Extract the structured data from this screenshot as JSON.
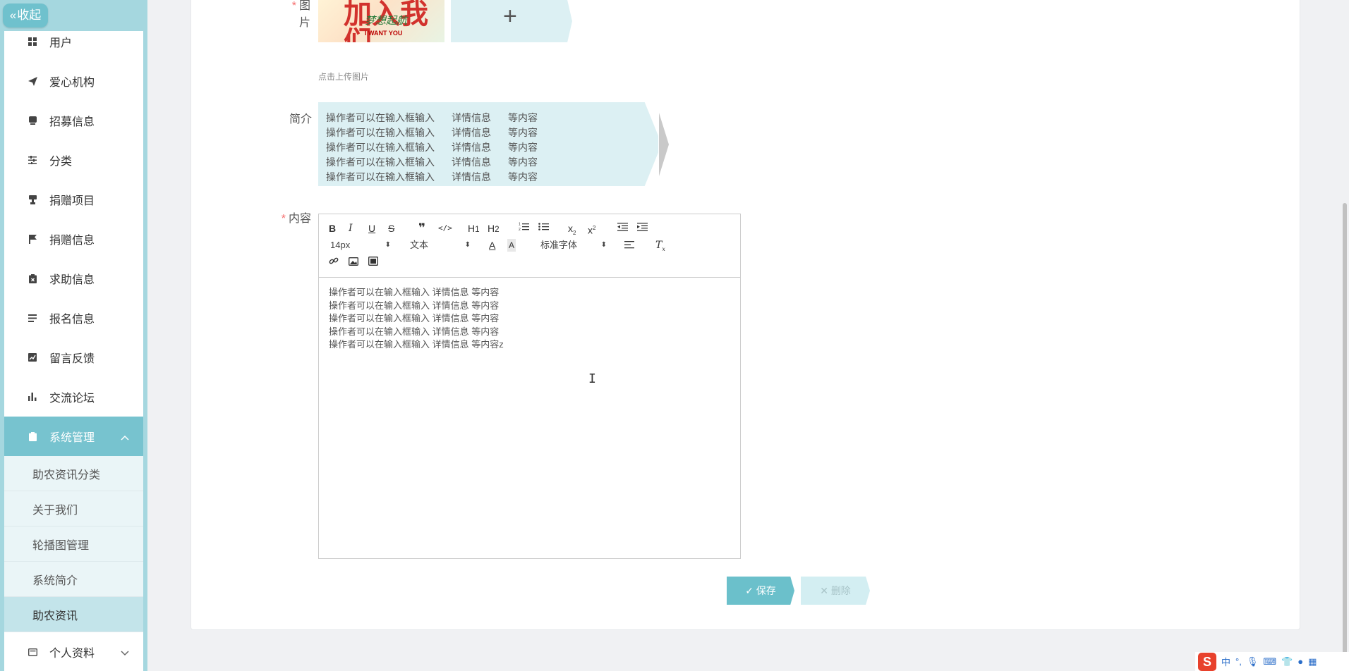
{
  "sidebar": {
    "collapse_label": "收起",
    "items": [
      {
        "label": "用户",
        "icon": "grid-icon"
      },
      {
        "label": "爱心机构",
        "icon": "send-icon"
      },
      {
        "label": "招募信息",
        "icon": "bookmark-icon"
      },
      {
        "label": "分类",
        "icon": "sliders-icon"
      },
      {
        "label": "捐赠项目",
        "icon": "stamp-icon"
      },
      {
        "label": "捐赠信息",
        "icon": "flag-icon"
      },
      {
        "label": "求助信息",
        "icon": "clipboard-x-icon"
      },
      {
        "label": "报名信息",
        "icon": "list-icon"
      },
      {
        "label": "留言反馈",
        "icon": "chart-line-icon"
      },
      {
        "label": "交流论坛",
        "icon": "bar-chart-icon"
      },
      {
        "label": "系统管理",
        "icon": "clipboard-icon"
      }
    ],
    "sub_items": [
      "助农资讯分类",
      "关于我们",
      "轮播图管理",
      "系统简介",
      "助农资讯"
    ],
    "profile_label": "个人资料"
  },
  "form": {
    "image_label": "图片",
    "upload_hint": "点击上传图片",
    "thumb_text_main": "加入我们",
    "thumb_text_sub": "梦想起航",
    "thumb_text_en": "I WANT YOU",
    "intro_label": "简介",
    "intro_lines": [
      [
        "操作者可以在输入框输入",
        "详情信息",
        "等内容"
      ],
      [
        "操作者可以在输入框输入",
        "详情信息",
        "等内容"
      ],
      [
        "操作者可以在输入框输入",
        "详情信息",
        "等内容"
      ],
      [
        "操作者可以在输入框输入",
        "详情信息",
        "等内容"
      ],
      [
        "操作者可以在输入框输入",
        "详情信息",
        "等内容"
      ]
    ],
    "content_label": "内容",
    "required_mark": "*",
    "toolbar": {
      "font_size": "14px",
      "block_type": "文本",
      "font_family": "标准字体"
    },
    "content_lines": [
      "操作者可以在输入框输入  详情信息  等内容",
      "操作者可以在输入框输入  详情信息  等内容",
      "操作者可以在输入框输入  详情信息  等内容",
      "操作者可以在输入框输入  详情信息  等内容",
      "操作者可以在输入框输入  详情信息  等内容z"
    ],
    "save_label": "保存",
    "delete_label": "删除"
  },
  "ime": {
    "logo": "S",
    "mode": "中"
  },
  "colors": {
    "accent": "#77c3cf",
    "sidebar_bg": "#a5d7df",
    "input_bg": "#dcf0f3",
    "required": "#f56c6c"
  }
}
